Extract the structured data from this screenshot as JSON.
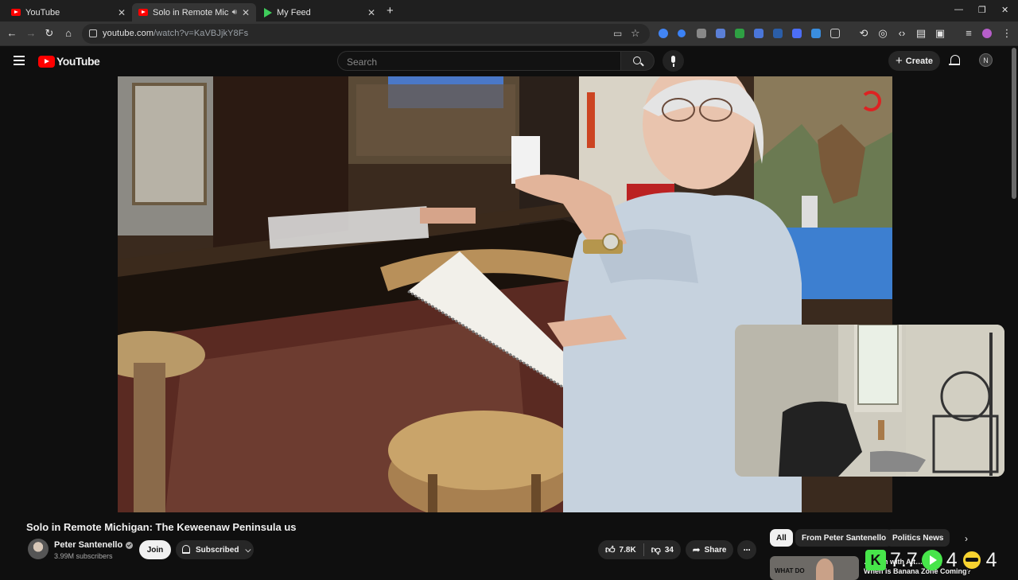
{
  "browser": {
    "tabs": [
      {
        "title": "YouTube",
        "icon": "youtube-icon",
        "active": false
      },
      {
        "title": "Solo in Remote Michigan: Th",
        "icon": "youtube-icon",
        "active": true
      },
      {
        "title": "My Feed",
        "icon": "feed-play-icon",
        "active": false
      }
    ],
    "url_host": "youtube.com",
    "url_path": "/watch?v=KaVBJjkY8Fs"
  },
  "youtube": {
    "logo_text": "YouTube",
    "search_placeholder": "Search",
    "create_label": "Create",
    "avatar_letter": "N"
  },
  "video": {
    "title": "Solo in Remote Michigan: The Keweenaw Peninsula us",
    "channel_name": "Peter Santenello",
    "subscribers": "3.99M subscribers",
    "join_label": "Join",
    "subscribed_label": "Subscribed",
    "likes": "7.8K",
    "dislikes": "34",
    "share_label": "Share"
  },
  "chips": [
    {
      "label": "All",
      "active": true
    },
    {
      "label": "From Peter Santenello",
      "active": false
    },
    {
      "label": "Politics News",
      "active": false
    }
  ],
  "related": {
    "thumb_text": "WHAT DO",
    "title_line1": "…tcoin with Alt…ainer|",
    "title_line2": "When is Banana Zone Coming?"
  },
  "overlay": {
    "num1": "7.7",
    "num2": "4",
    "num3": "4"
  },
  "colors": {
    "youtube_red": "#ff0000",
    "bg": "#0f0f0f",
    "chip_bg": "#272727",
    "overlay_green": "#47e54a"
  }
}
